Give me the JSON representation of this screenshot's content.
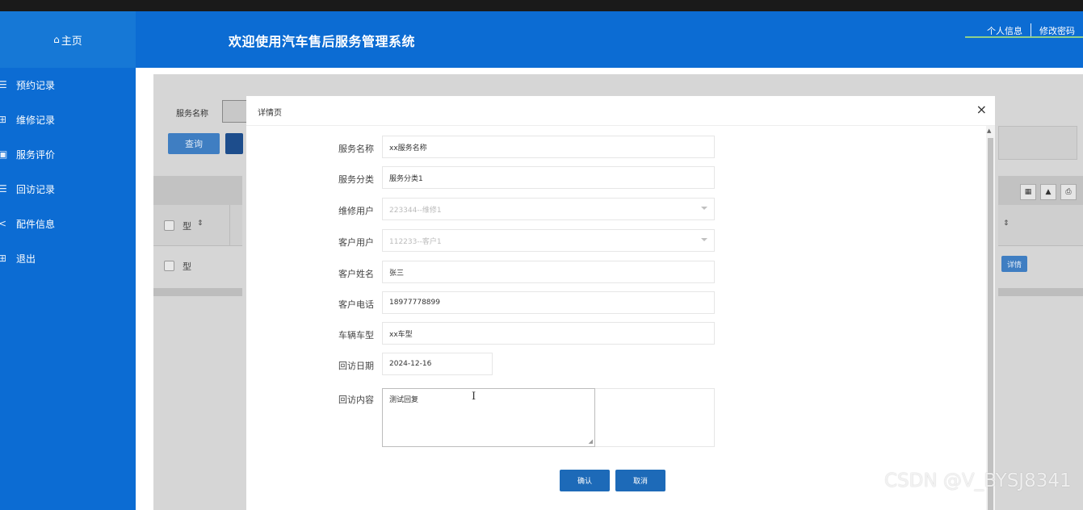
{
  "header": {
    "home_label": "主页",
    "title": "欢迎使用汽车售后服务管理系统",
    "links": [
      "个人信息",
      "修改密码"
    ]
  },
  "sidebar": {
    "items": [
      {
        "icon": "list-icon",
        "glyph": "☰",
        "label": "预约记录"
      },
      {
        "icon": "grid-icon",
        "glyph": "⊞",
        "label": "维修记录"
      },
      {
        "icon": "monitor-icon",
        "glyph": "▣",
        "label": "服务评价"
      },
      {
        "icon": "list-icon",
        "glyph": "☰",
        "label": "回访记录"
      },
      {
        "icon": "share-icon",
        "glyph": "<",
        "label": "配件信息"
      },
      {
        "icon": "grid-icon",
        "glyph": "⊞",
        "label": "退出"
      }
    ]
  },
  "background": {
    "search_label": "服务名称",
    "query_button": "查询",
    "col_header": "型",
    "row_cell": "型",
    "detail_button": "详情"
  },
  "modal": {
    "title": "详情页",
    "close_glyph": "×",
    "fields": [
      {
        "label": "服务名称",
        "value": "xx服务名称",
        "type": "text"
      },
      {
        "label": "服务分类",
        "value": "服务分类1",
        "type": "text"
      },
      {
        "label": "维修用户",
        "value": "223344--维修1",
        "type": "select"
      },
      {
        "label": "客户用户",
        "value": "112233--客户1",
        "type": "select"
      },
      {
        "label": "客户姓名",
        "value": "张三",
        "type": "text"
      },
      {
        "label": "客户电话",
        "value": "18977778899",
        "type": "text"
      },
      {
        "label": "车辆车型",
        "value": "xx车型",
        "type": "text"
      },
      {
        "label": "回访日期",
        "value": "2024-12-16",
        "type": "date"
      },
      {
        "label": "回访内容",
        "value": "测试回复",
        "type": "textarea"
      }
    ],
    "confirm_button": "确认",
    "cancel_button": "取消"
  },
  "watermark": "CSDN @V_BYSJ8341",
  "colors": {
    "brand_blue": "#0c6cd3",
    "button_blue": "#1d6ab8"
  }
}
